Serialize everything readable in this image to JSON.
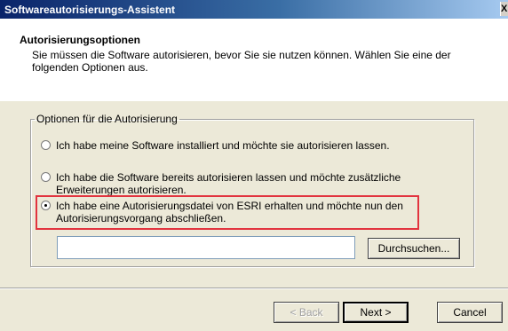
{
  "window": {
    "title": "Softwareautorisierungs-Assistent",
    "close_glyph": "X"
  },
  "header": {
    "title": "Autorisierungsoptionen",
    "description": "Sie müssen die Software autorisieren, bevor Sie sie nutzen können. Wählen Sie eine der folgenden Optionen aus."
  },
  "options_group": {
    "legend": "Optionen für die Autorisierung",
    "options": [
      {
        "label": "Ich habe meine Software installiert und möchte sie autorisieren lassen.",
        "selected": false
      },
      {
        "label": "Ich habe die Software bereits autorisieren lassen und möchte zusätzliche Erweiterungen autorisieren.",
        "selected": false
      },
      {
        "label": "Ich habe eine Autorisierungsdatei von ESRI erhalten und möchte nun den Autorisierungsvorgang abschließen.",
        "selected": true
      }
    ]
  },
  "file_path": {
    "value": "",
    "placeholder": ""
  },
  "buttons": {
    "browse": "Durchsuchen...",
    "back": "< Back",
    "next": "Next >",
    "cancel": "Cancel"
  },
  "colors": {
    "highlight_box": "#e2343f",
    "title_bar": "#0a246a"
  }
}
